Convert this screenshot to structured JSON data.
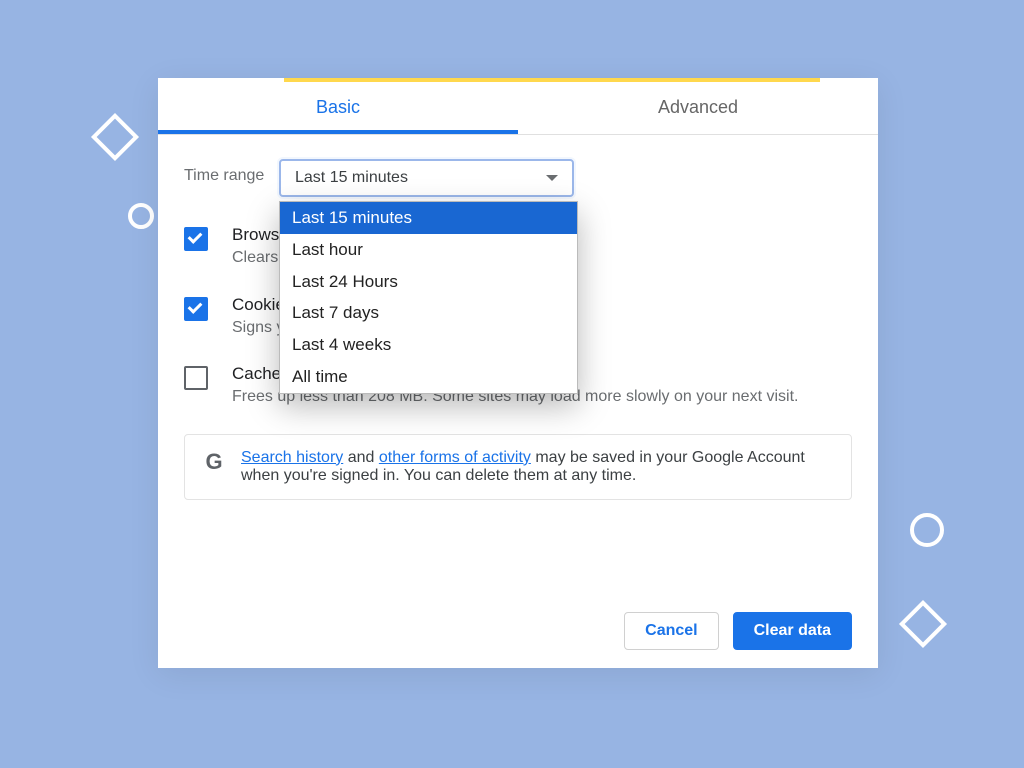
{
  "tabs": {
    "basic": "Basic",
    "advanced": "Advanced"
  },
  "timerange": {
    "label": "Time range",
    "selected": "Last 15 minutes",
    "options": [
      "Last 15 minutes",
      "Last hour",
      "Last 24 Hours",
      "Last 7 days",
      "Last 4 weeks",
      "All time"
    ]
  },
  "items": [
    {
      "title": "Browsing history",
      "desc": "Clears history"
    },
    {
      "title": "Cookies and other site data",
      "desc": "Signs you out of most sites"
    },
    {
      "title": "Cached images and files",
      "desc": "Frees up less than 208 MB. Some sites may load more slowly on your next visit."
    }
  ],
  "info": {
    "link1": "Search history",
    "mid1": " and ",
    "link2": "other forms of activity",
    "tail": " may be saved in your Google Account when you're signed in. You can delete them at any time."
  },
  "buttons": {
    "cancel": "Cancel",
    "clear": "Clear data"
  },
  "g": "G"
}
